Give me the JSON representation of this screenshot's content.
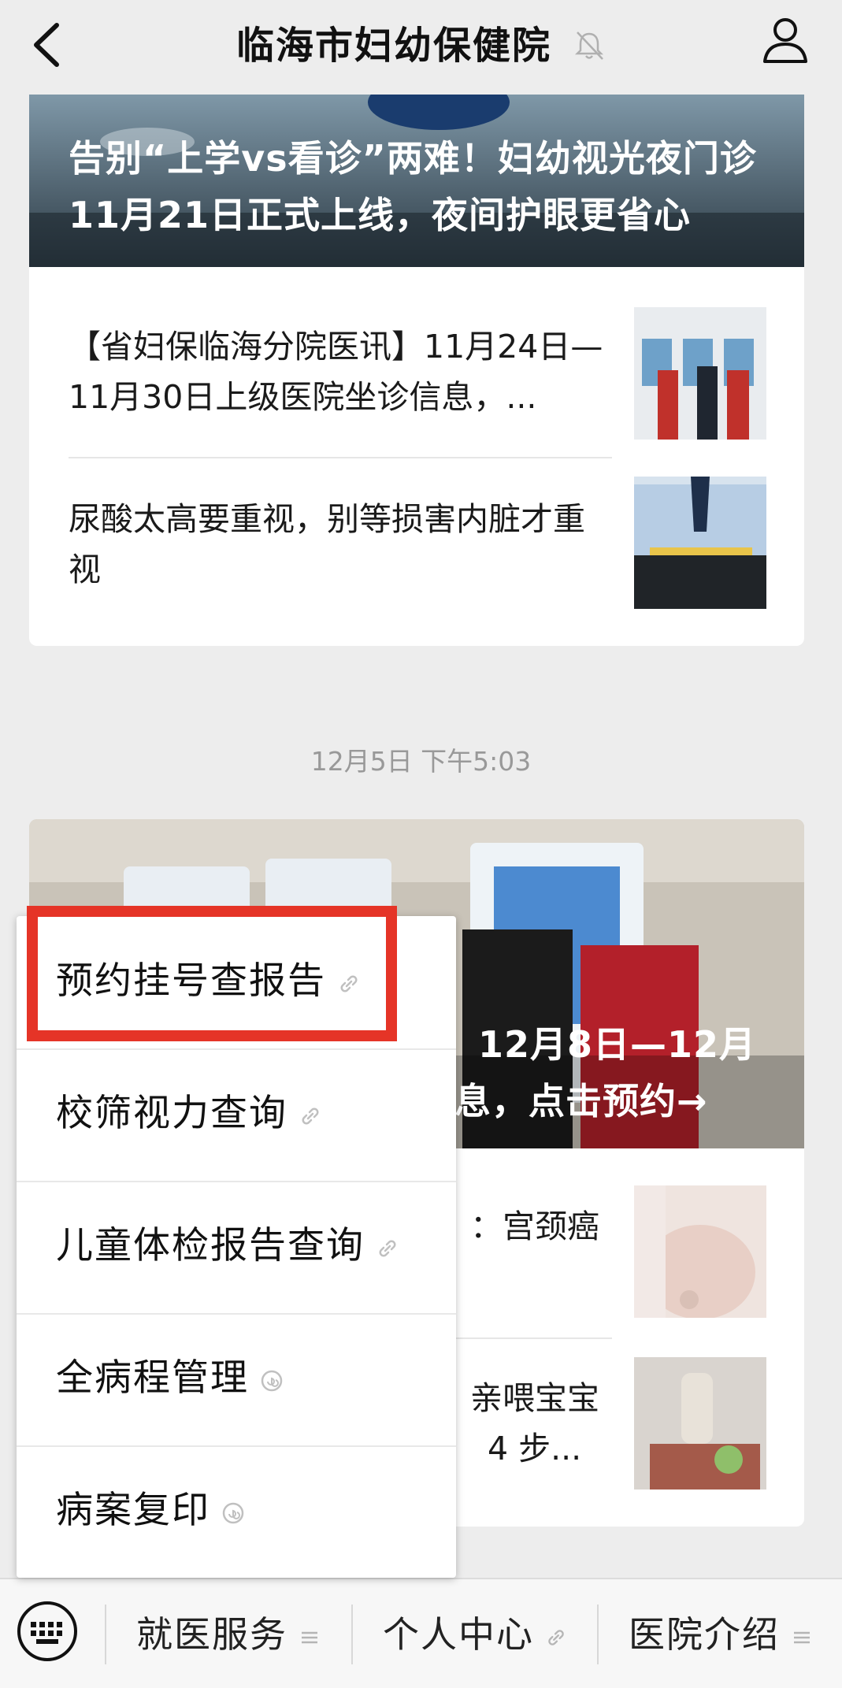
{
  "header": {
    "title": "临海市妇幼保健院"
  },
  "feed": {
    "card1": {
      "hero_title": "告别“上学vs看诊”两难！妇幼视光夜门诊11月21日正式上线，夜间护眼更省心",
      "items": [
        {
          "text": "【省妇保临海分院医讯】11月24日—11月30日上级医院坐诊信息，..."
        },
        {
          "text": "尿酸太高要重视，别等损害内脏才重视"
        }
      ]
    },
    "timestamp": "12月5日 下午5:03",
    "card2": {
      "hero_title_line1": "12月8日—12月",
      "hero_title_line2": "息，点击预约→",
      "items": [
        {
          "text": "：宫颈癌"
        },
        {
          "text_line1": "亲喂宝宝",
          "text_line2": "4 步..."
        }
      ]
    }
  },
  "popup_menu": {
    "items": [
      {
        "label": "预约挂号查报告"
      },
      {
        "label": "校筛视力查询"
      },
      {
        "label": "儿童体检报告查询"
      },
      {
        "label": "全病程管理"
      },
      {
        "label": "病案复印"
      }
    ]
  },
  "bottom_bar": {
    "tabs": [
      {
        "label": "就医服务",
        "icon": "menu-lines-icon"
      },
      {
        "label": "个人中心",
        "icon": "link-icon"
      },
      {
        "label": "医院介绍",
        "icon": "menu-lines-icon"
      }
    ]
  },
  "colors": {
    "highlight": "#e53427",
    "background": "#ededed"
  }
}
